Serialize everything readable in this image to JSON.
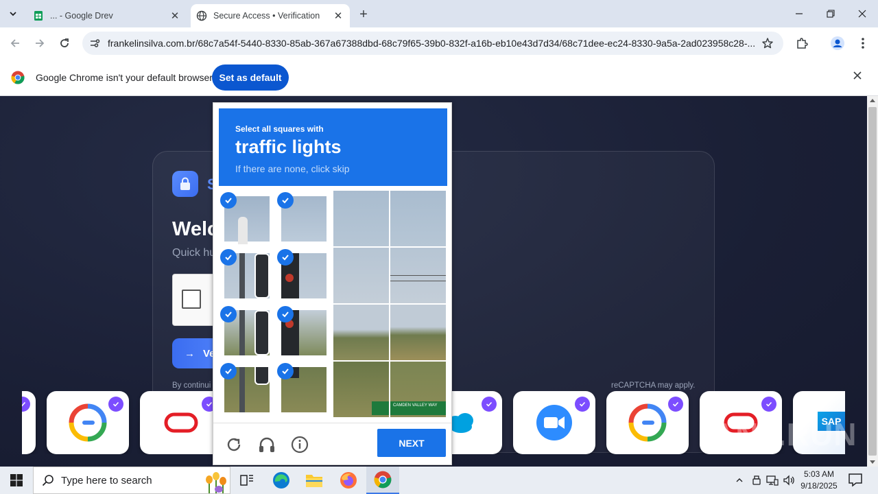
{
  "browser": {
    "tabs": [
      {
        "title": "... - Google Drev",
        "active": false,
        "icon": "google-sheets-icon"
      },
      {
        "title": "Secure Access • Verification",
        "active": true,
        "icon": "globe-icon"
      }
    ],
    "url": "frankelinsilva.com.br/68c7a54f-5440-8330-85ab-367a67388dbd-68c79f65-39b0-832f-a16b-eb10e43d7d34/68c71dee-ec24-8330-9a5a-2ad023958c28-...",
    "infobar": {
      "message": "Google Chrome isn't your default browser",
      "button": "Set as default"
    }
  },
  "page": {
    "brand_initial": "S",
    "welcome": "Welc",
    "subtitle": "Quick hu",
    "verify_label": "Ve",
    "by_continuing": "By continui",
    "recaptcha_apply": "reCAPTCHA may apply.",
    "watermark": "ANY.RUN",
    "logos": [
      "partial-logo",
      "google-one-logo",
      "oracle-logo",
      "salesforce-cloud-logo",
      "zoom-logo",
      "google-one-logo",
      "oracle-logo",
      "sap-logo"
    ],
    "sap_text": "SAP"
  },
  "captcha": {
    "instruction_top": "Select all squares with",
    "target": "traffic lights",
    "instruction_bottom": "If there are none, click skip",
    "selected_cells": [
      0,
      1,
      4,
      5,
      8,
      9,
      12,
      13
    ],
    "sign_text": "CAMDEN VALLEY WAY",
    "next_label": "NEXT"
  },
  "taskbar": {
    "search_placeholder": "Type here to search",
    "time": "5:03 AM",
    "date": "9/18/2025"
  },
  "colors": {
    "captcha_blue": "#1a73e8",
    "chrome_blue_button": "#0b57d0",
    "page_bg": "#1a1f35",
    "badge_purple": "#7c4dff"
  }
}
